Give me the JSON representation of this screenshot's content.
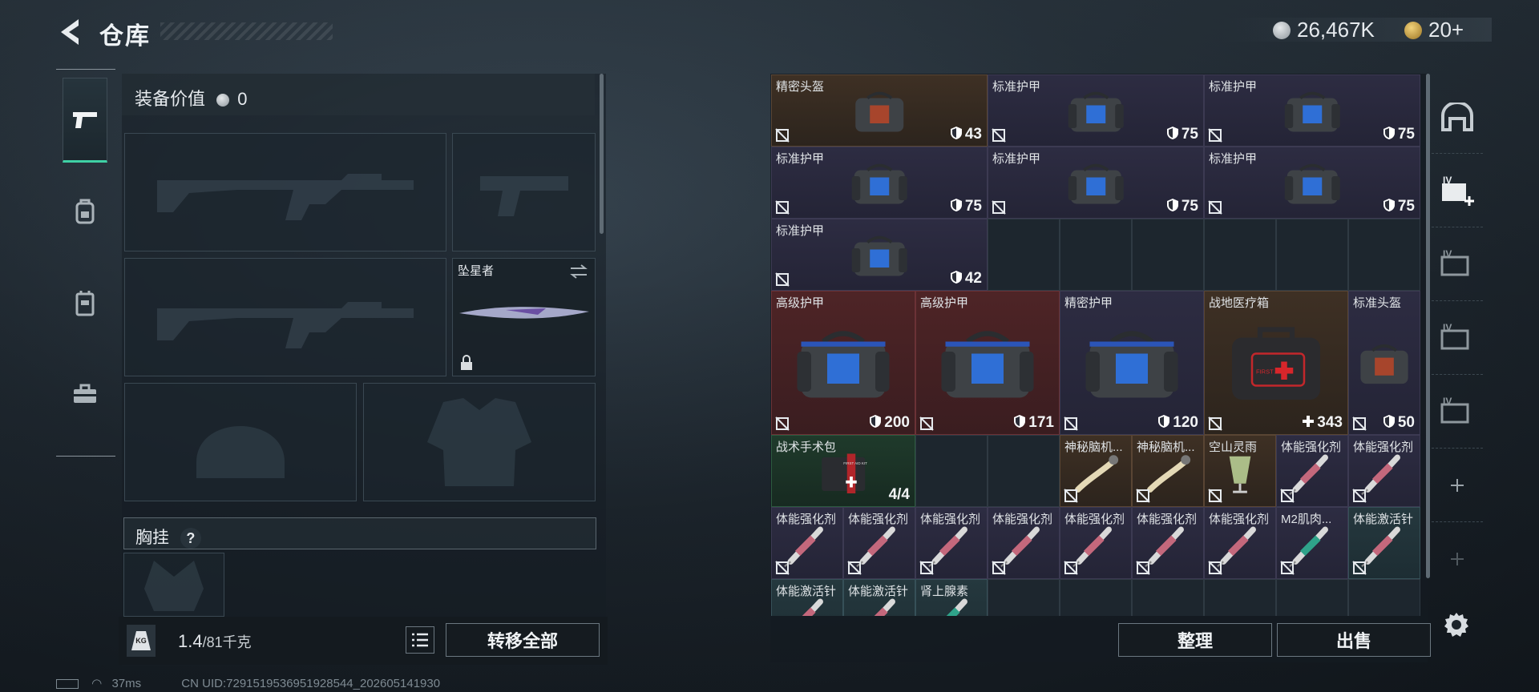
{
  "header": {
    "title": "仓库"
  },
  "currency": {
    "coins": "26,467K",
    "tokens": "20+"
  },
  "equipment": {
    "value_label": "装备价值",
    "value": "0",
    "melee_name": "坠星者",
    "chest_label": "胸挂",
    "chest_help": "?",
    "weight_current": "1.4",
    "weight_max": "/81千克",
    "weight_icon_text": "KG",
    "transfer_all": "转移全部"
  },
  "inventory": {
    "items": [
      {
        "name": "精密头盔",
        "value": "43"
      },
      {
        "name": "标准护甲",
        "value": "75"
      },
      {
        "name": "标准护甲",
        "value": "75"
      },
      {
        "name": "标准护甲",
        "value": "75"
      },
      {
        "name": "标准护甲",
        "value": "75"
      },
      {
        "name": "标准护甲",
        "value": "75"
      },
      {
        "name": "标准护甲",
        "value": "42"
      },
      {
        "name": "高级护甲",
        "value": "200"
      },
      {
        "name": "高级护甲",
        "value": "171"
      },
      {
        "name": "精密护甲",
        "value": "120"
      },
      {
        "name": "战地医疗箱",
        "value": "343"
      },
      {
        "name": "标准头盔",
        "value": "50"
      },
      {
        "name": "战术手术包",
        "value": "4/4"
      },
      {
        "name": "神秘脑机...",
        "value": ""
      },
      {
        "name": "神秘脑机...",
        "value": ""
      },
      {
        "name": "空山灵雨",
        "value": ""
      },
      {
        "name": "体能强化剂",
        "value": ""
      },
      {
        "name": "体能强化剂",
        "value": ""
      },
      {
        "name": "体能强化剂",
        "value": ""
      },
      {
        "name": "体能强化剂",
        "value": ""
      },
      {
        "name": "体能强化剂",
        "value": ""
      },
      {
        "name": "体能强化剂",
        "value": ""
      },
      {
        "name": "体能强化剂",
        "value": ""
      },
      {
        "name": "体能强化剂",
        "value": ""
      },
      {
        "name": "体能强化剂",
        "value": ""
      },
      {
        "name": "M2肌肉...",
        "value": ""
      },
      {
        "name": "体能激活针",
        "value": ""
      },
      {
        "name": "体能激活针",
        "value": ""
      },
      {
        "name": "体能激活针",
        "value": ""
      },
      {
        "name": "肾上腺素",
        "value": ""
      }
    ],
    "sort_button": "整理",
    "sell_button": "出售",
    "medkit_label": "FIRST AID",
    "surgery_kit_label": "FIRST AID KIT"
  },
  "side_tabs": {
    "tier_label": "IV"
  },
  "status": {
    "ping": "37ms",
    "uid": "CN UID:7291519536951928544_202605141930"
  },
  "colors": {
    "accent": "#3fd1a5",
    "armor_bg": "#2d2c42",
    "red_bg": "#4e2426",
    "brown_bg": "#3e3024"
  }
}
